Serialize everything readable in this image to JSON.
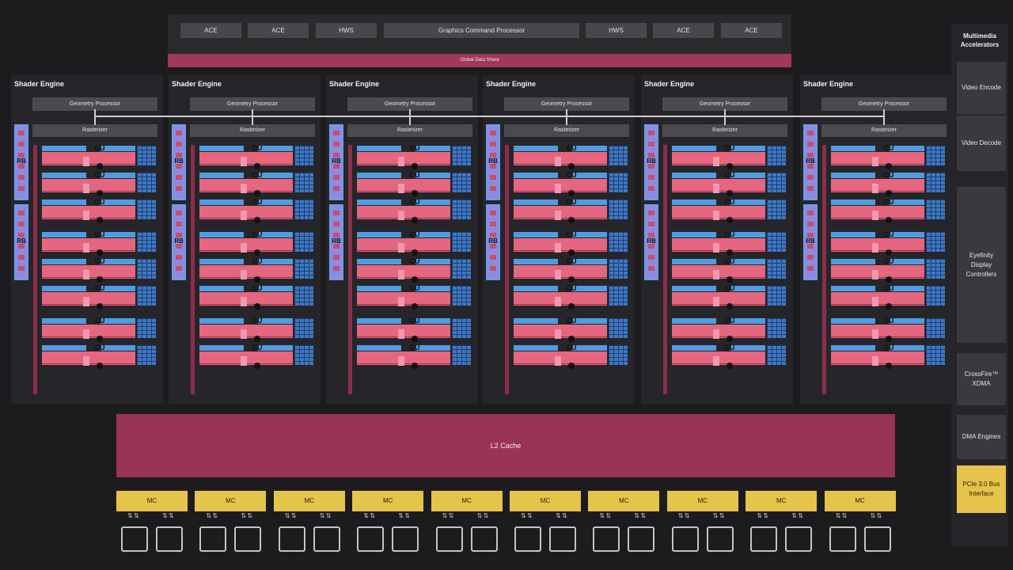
{
  "top": {
    "buttons": [
      "ACE",
      "ACE",
      "HWS",
      "Graphics Command Processor",
      "HWS",
      "ACE",
      "ACE"
    ],
    "global_data_share": "Global Data Share"
  },
  "shader_engine": {
    "title": "Shader Engine",
    "geometry_processor": "Geometry Processor",
    "rasterizer": "Rasterizer",
    "rb_label": "RB",
    "cu_label": "CU"
  },
  "l2_cache": "L2 Cache",
  "mc_label": "MC",
  "side": {
    "title": "Multimedia Accelerators",
    "video_encode": "Video Encode",
    "video_decode": "Video Decode",
    "eyefinity": "Eyefinity Display Controllers",
    "crossfire": "CrossFire™ XDMA",
    "dma": "DMA Engines",
    "pcie": "PCIe 3.0 Bus Interface"
  },
  "colors": {
    "background": "#1c1c1e",
    "gds": "#a0385c",
    "l2": "#9a3358",
    "mc": "#e6c34a",
    "cu_blue": "#4f9ce0",
    "cu_pink": "#e5667f",
    "rb": "#8d8be0"
  }
}
